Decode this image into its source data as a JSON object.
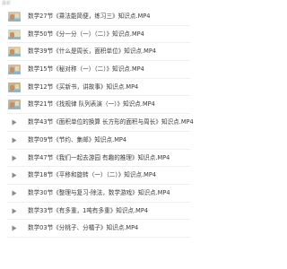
{
  "header": {
    "label": "最新"
  },
  "files": [
    {
      "name": "数学27节《乘法能简便，练习三》知识点.MP4",
      "icon": "video-thumbnail-icon",
      "thumb_colors": [
        "#d8c7a3",
        "#a7c4d6"
      ]
    },
    {
      "name": "数学50节《分一分（一）（二）》知识点.MP4",
      "icon": "video-thumbnail-icon",
      "thumb_colors": [
        "#c9d6b8",
        "#e8e0c8"
      ]
    },
    {
      "name": "数学39节《什么是周长，面积单位》知识点.MP4",
      "icon": "video-thumbnail-icon",
      "thumb_colors": [
        "#e0c9a6",
        "#b7d0c1"
      ]
    },
    {
      "name": "数学15节《秘对称（一）（二）》知识点.MP4",
      "icon": "video-thumbnail-icon",
      "thumb_colors": [
        "#d9b99a",
        "#9fc0cc"
      ]
    },
    {
      "name": "数学12节《买新书，讲故事》知识点.MP4",
      "icon": "video-thumbnail-icon",
      "thumb_colors": [
        "#cbb08a",
        "#a9c7b5"
      ]
    },
    {
      "name": "数学21节《找规律 队列表演（一）》知识点.MP4",
      "icon": "video-thumbnail-icon",
      "thumb_colors": [
        "#d2b48c",
        "#9db9c9"
      ]
    },
    {
      "name": "数学43节《面积单位的换算 长方形的面积与周长》知识点.MP4",
      "icon": "play-icon"
    },
    {
      "name": "数学09节《节约、集邮》知识点.MP4",
      "icon": "play-icon"
    },
    {
      "name": "数学47节《我们一起去游园 有趣的推理》知识点.MP4",
      "icon": "play-icon"
    },
    {
      "name": "数学18节《平移和旋转（一）（二）》知识点.MP4",
      "icon": "play-icon"
    },
    {
      "name": "数学30节《整理与复习-除法，数学游戏》知识点.MP4",
      "icon": "play-icon"
    },
    {
      "name": "数学33节《有多重，1吨有多重》知识点.MP4",
      "icon": "play-icon"
    },
    {
      "name": "数学03节《分桃子、分橘子》知识点.MP4",
      "icon": "play-icon"
    }
  ],
  "colors": {
    "text": "#3a3a3a",
    "header": "#b8b8b8",
    "play_icon": "#8a8a8a",
    "divider": "#efefef"
  }
}
